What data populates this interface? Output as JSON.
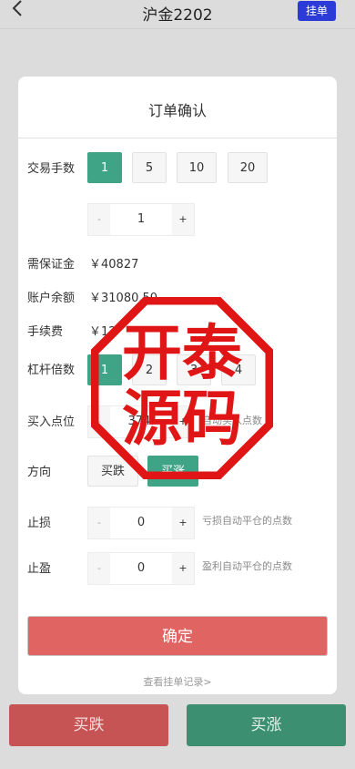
{
  "header": {
    "title": "沪金2202",
    "pending_label": "挂单"
  },
  "card": {
    "title": "订单确认",
    "lots": {
      "label": "交易手数",
      "options": [
        "1",
        "5",
        "10",
        "20"
      ],
      "selected": "1"
    },
    "lot_stepper": {
      "minus": "-",
      "value": "1",
      "plus": "+"
    },
    "margin": {
      "label": "需保证金",
      "value": "￥40827"
    },
    "balance": {
      "label": "账户余额",
      "value": "￥31080.50"
    },
    "fee": {
      "label": "手续费",
      "value": "￥12"
    },
    "leverage": {
      "label": "杠杆倍数",
      "options": [
        "1",
        "2",
        "3",
        "4"
      ],
      "selected": "1"
    },
    "entry": {
      "label": "买入点位",
      "minus": "-",
      "value": "374.",
      "plus": "+",
      "hint": "自动买入点数"
    },
    "direction": {
      "label": "方向",
      "options": [
        "买跌",
        "买涨"
      ],
      "selected": "买涨"
    },
    "stop_loss": {
      "label": "止损",
      "minus": "-",
      "value": "0",
      "plus": "+",
      "hint": "亏损自动平仓的点数"
    },
    "take_profit": {
      "label": "止盈",
      "minus": "-",
      "value": "0",
      "plus": "+",
      "hint": "盈利自动平仓的点数"
    },
    "confirm_label": "确定",
    "records_link": "查看挂单记录>"
  },
  "bottom": {
    "fall_label": "买跌",
    "rise_label": "买涨"
  },
  "watermark": {
    "text_lines": [
      "开泰",
      "源码"
    ],
    "color": "#e01616"
  },
  "colors": {
    "accent_green": "#3fa486",
    "confirm_red": "#e06461",
    "pending_blue": "#2c3bd8"
  }
}
